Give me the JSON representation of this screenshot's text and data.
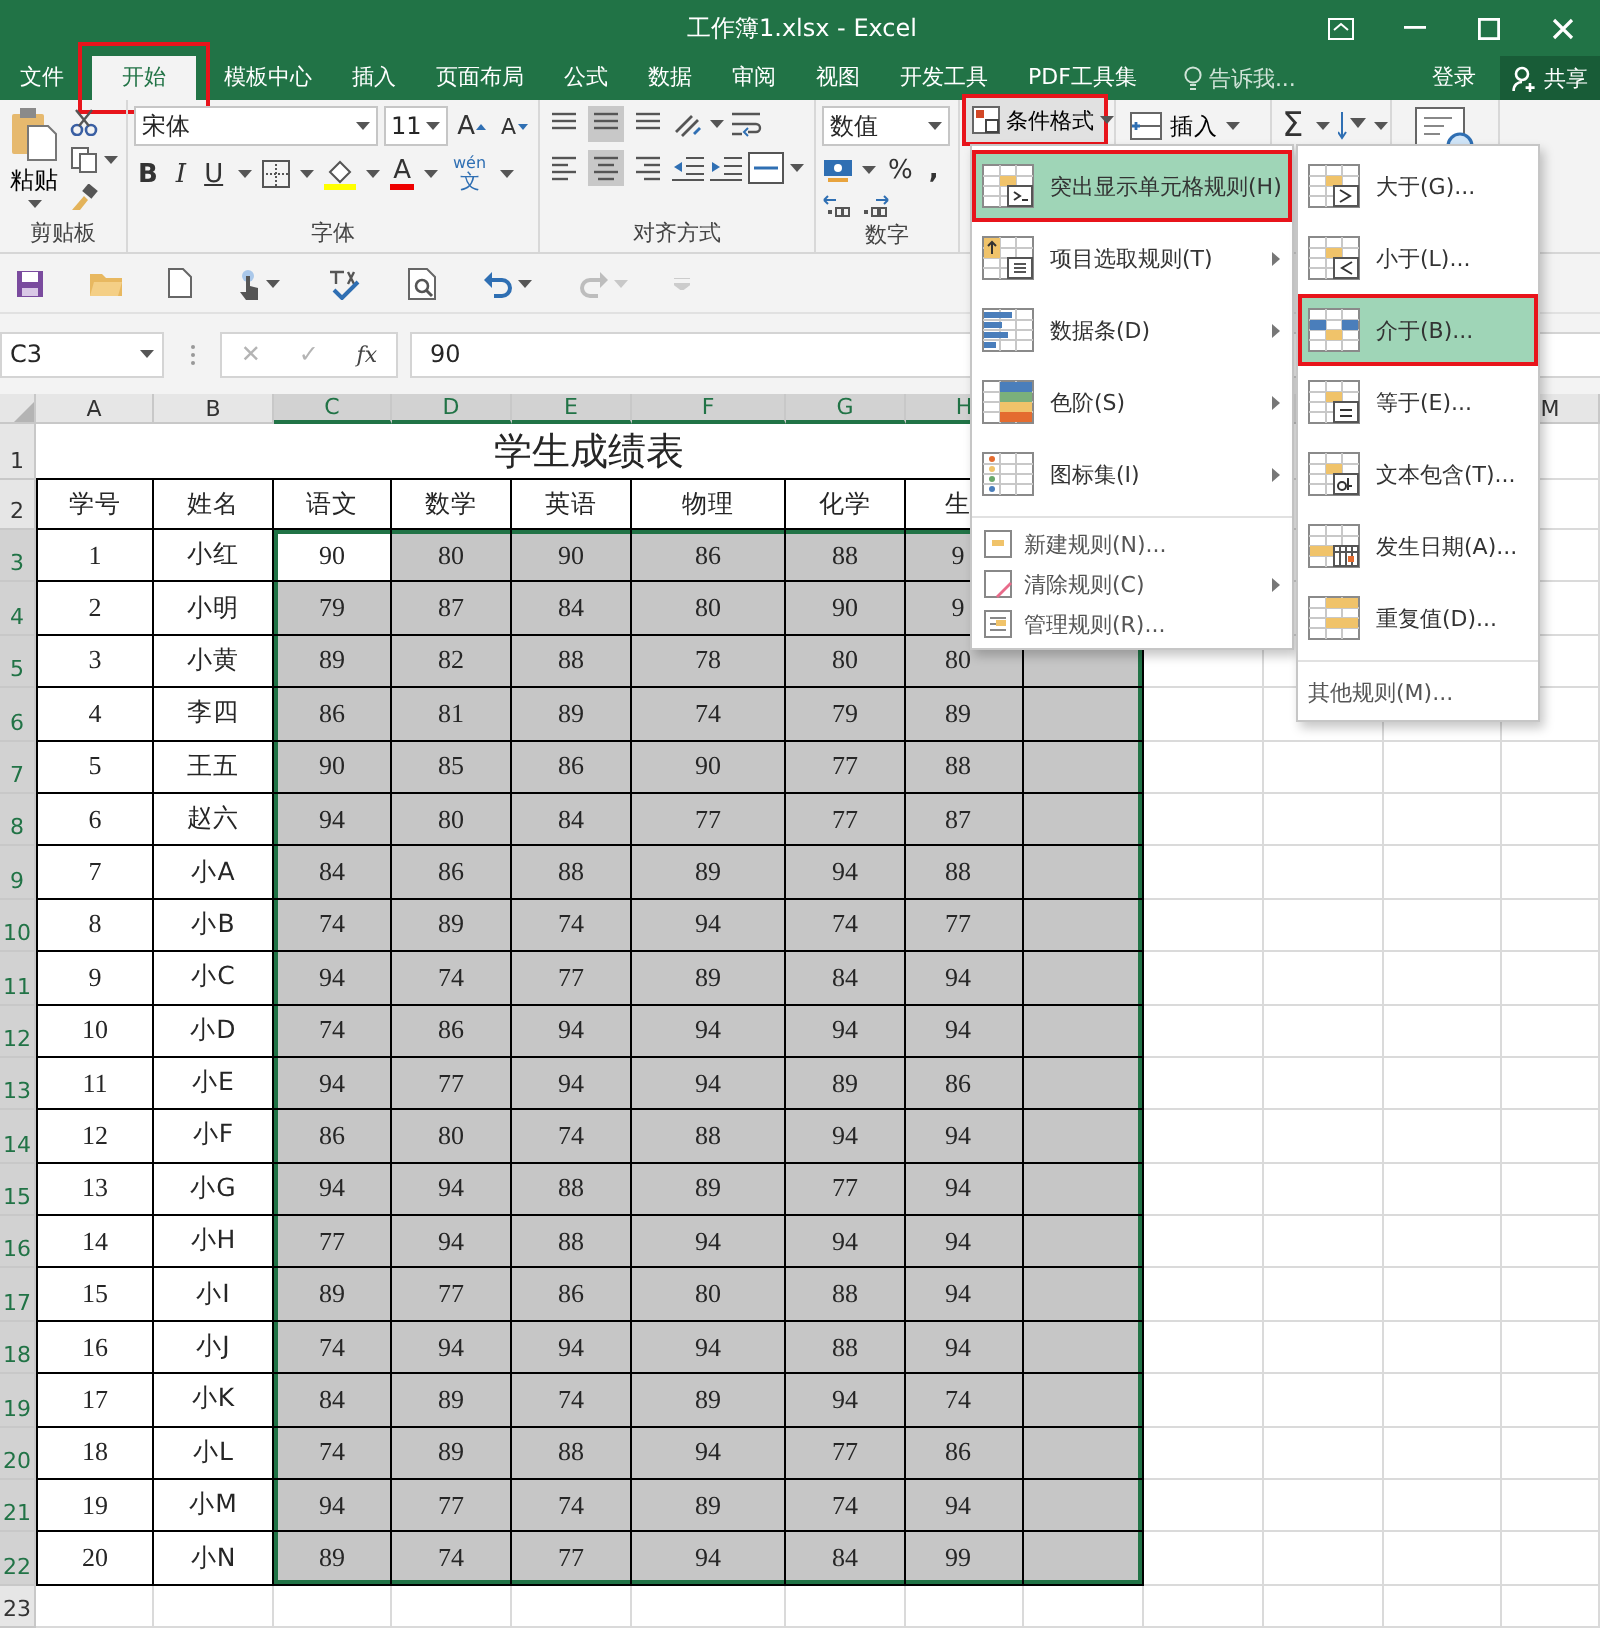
{
  "window": {
    "title": "工作簿1.xlsx - Excel"
  },
  "tabs": [
    {
      "label": "文件",
      "selected": false,
      "outlined": false
    },
    {
      "label": "开始",
      "selected": true,
      "outlined": true
    },
    {
      "label": "模板中心",
      "selected": false,
      "outlined": false
    },
    {
      "label": "插入",
      "selected": false,
      "outlined": false
    },
    {
      "label": "页面布局",
      "selected": false,
      "outlined": false
    },
    {
      "label": "公式",
      "selected": false,
      "outlined": false
    },
    {
      "label": "数据",
      "selected": false,
      "outlined": false
    },
    {
      "label": "审阅",
      "selected": false,
      "outlined": false
    },
    {
      "label": "视图",
      "selected": false,
      "outlined": false
    },
    {
      "label": "开发工具",
      "selected": false,
      "outlined": false
    },
    {
      "label": "PDF工具集",
      "selected": false,
      "outlined": false
    }
  ],
  "tell_me": {
    "placeholder": "告诉我..."
  },
  "account": {
    "sign_in": "登录",
    "share": "共享"
  },
  "ribbon": {
    "clipboard": {
      "paste": "粘贴",
      "label": "剪贴板"
    },
    "font": {
      "name": "宋体",
      "size": "11",
      "grow": "A",
      "shrink": "A",
      "bold": "B",
      "italic": "I",
      "underline": "U",
      "color_letter": "A",
      "phonetic_top": "wén",
      "phonetic_bottom": "文",
      "label": "字体"
    },
    "alignment": {
      "label": "对齐方式"
    },
    "number": {
      "format": "数值",
      "percent": "%",
      "comma": ",",
      "label": "数字"
    },
    "conditional_format": {
      "label": "条件格式",
      "outlined": true
    },
    "insert": {
      "label": "插入"
    },
    "sum": "Σ"
  },
  "formula_bar": {
    "name_box": "C3",
    "cancel": "✕",
    "enter": "✓",
    "fx": "fx",
    "value": "90"
  },
  "sheet": {
    "columns": [
      {
        "label": "A",
        "selected": false
      },
      {
        "label": "B",
        "selected": false
      },
      {
        "label": "C",
        "selected": true
      },
      {
        "label": "D",
        "selected": true
      },
      {
        "label": "E",
        "selected": true
      },
      {
        "label": "F",
        "selected": true
      },
      {
        "label": "G",
        "selected": true
      },
      {
        "label": "H",
        "selected": true
      }
    ],
    "column_m": {
      "label": "M",
      "selected": false
    },
    "title_row": "1",
    "title": "学生成绩表",
    "header_row": "2",
    "header": [
      "学号",
      "姓名",
      "语文",
      "数学",
      "英语",
      "物理",
      "化学",
      "生"
    ],
    "rows": [
      {
        "number": "3",
        "selected": true,
        "id": "1",
        "name": "小红",
        "scores": [
          {
            "text": "90",
            "selected": false
          },
          {
            "text": "80",
            "selected": true
          },
          {
            "text": "90",
            "selected": true
          },
          {
            "text": "86",
            "selected": true
          },
          {
            "text": "88",
            "selected": true
          },
          {
            "text": "9",
            "selected": true
          }
        ]
      },
      {
        "number": "4",
        "selected": true,
        "id": "2",
        "name": "小明",
        "scores": [
          {
            "text": "79",
            "selected": true
          },
          {
            "text": "87",
            "selected": true
          },
          {
            "text": "84",
            "selected": true
          },
          {
            "text": "80",
            "selected": true
          },
          {
            "text": "90",
            "selected": true
          },
          {
            "text": "9",
            "selected": true
          }
        ]
      },
      {
        "number": "5",
        "selected": true,
        "id": "3",
        "name": "小黄",
        "blank_selected": true,
        "scores": [
          {
            "text": "89",
            "selected": true
          },
          {
            "text": "82",
            "selected": true
          },
          {
            "text": "88",
            "selected": true
          },
          {
            "text": "78",
            "selected": true
          },
          {
            "text": "80",
            "selected": true
          },
          {
            "text": "80",
            "selected": true
          }
        ]
      },
      {
        "number": "6",
        "selected": true,
        "id": "4",
        "name": "李四",
        "blank_selected": true,
        "scores": [
          {
            "text": "86",
            "selected": true
          },
          {
            "text": "81",
            "selected": true
          },
          {
            "text": "89",
            "selected": true
          },
          {
            "text": "74",
            "selected": true
          },
          {
            "text": "79",
            "selected": true
          },
          {
            "text": "89",
            "selected": true
          }
        ]
      },
      {
        "number": "7",
        "selected": true,
        "id": "5",
        "name": "王五",
        "blank_selected": true,
        "scores": [
          {
            "text": "90",
            "selected": true
          },
          {
            "text": "85",
            "selected": true
          },
          {
            "text": "86",
            "selected": true
          },
          {
            "text": "90",
            "selected": true
          },
          {
            "text": "77",
            "selected": true
          },
          {
            "text": "88",
            "selected": true
          }
        ]
      },
      {
        "number": "8",
        "selected": true,
        "id": "6",
        "name": "赵六",
        "blank_selected": true,
        "scores": [
          {
            "text": "94",
            "selected": true
          },
          {
            "text": "80",
            "selected": true
          },
          {
            "text": "84",
            "selected": true
          },
          {
            "text": "77",
            "selected": true
          },
          {
            "text": "77",
            "selected": true
          },
          {
            "text": "87",
            "selected": true
          }
        ]
      },
      {
        "number": "9",
        "selected": true,
        "id": "7",
        "name": "小A",
        "blank_selected": true,
        "scores": [
          {
            "text": "84",
            "selected": true
          },
          {
            "text": "86",
            "selected": true
          },
          {
            "text": "88",
            "selected": true
          },
          {
            "text": "89",
            "selected": true
          },
          {
            "text": "94",
            "selected": true
          },
          {
            "text": "88",
            "selected": true
          }
        ]
      },
      {
        "number": "10",
        "selected": true,
        "id": "8",
        "name": "小B",
        "blank_selected": true,
        "scores": [
          {
            "text": "74",
            "selected": true
          },
          {
            "text": "89",
            "selected": true
          },
          {
            "text": "74",
            "selected": true
          },
          {
            "text": "94",
            "selected": true
          },
          {
            "text": "74",
            "selected": true
          },
          {
            "text": "77",
            "selected": true
          }
        ]
      },
      {
        "number": "11",
        "selected": true,
        "id": "9",
        "name": "小C",
        "blank_selected": true,
        "scores": [
          {
            "text": "94",
            "selected": true
          },
          {
            "text": "74",
            "selected": true
          },
          {
            "text": "77",
            "selected": true
          },
          {
            "text": "89",
            "selected": true
          },
          {
            "text": "84",
            "selected": true
          },
          {
            "text": "94",
            "selected": true
          }
        ]
      },
      {
        "number": "12",
        "selected": true,
        "id": "10",
        "name": "小D",
        "blank_selected": true,
        "scores": [
          {
            "text": "74",
            "selected": true
          },
          {
            "text": "86",
            "selected": true
          },
          {
            "text": "94",
            "selected": true
          },
          {
            "text": "94",
            "selected": true
          },
          {
            "text": "94",
            "selected": true
          },
          {
            "text": "94",
            "selected": true
          }
        ]
      },
      {
        "number": "13",
        "selected": true,
        "id": "11",
        "name": "小E",
        "blank_selected": true,
        "scores": [
          {
            "text": "94",
            "selected": true
          },
          {
            "text": "77",
            "selected": true
          },
          {
            "text": "94",
            "selected": true
          },
          {
            "text": "94",
            "selected": true
          },
          {
            "text": "89",
            "selected": true
          },
          {
            "text": "86",
            "selected": true
          }
        ]
      },
      {
        "number": "14",
        "selected": true,
        "id": "12",
        "name": "小F",
        "blank_selected": true,
        "scores": [
          {
            "text": "86",
            "selected": true
          },
          {
            "text": "80",
            "selected": true
          },
          {
            "text": "74",
            "selected": true
          },
          {
            "text": "88",
            "selected": true
          },
          {
            "text": "94",
            "selected": true
          },
          {
            "text": "94",
            "selected": true
          }
        ]
      },
      {
        "number": "15",
        "selected": true,
        "id": "13",
        "name": "小G",
        "blank_selected": true,
        "scores": [
          {
            "text": "94",
            "selected": true
          },
          {
            "text": "94",
            "selected": true
          },
          {
            "text": "88",
            "selected": true
          },
          {
            "text": "89",
            "selected": true
          },
          {
            "text": "77",
            "selected": true
          },
          {
            "text": "94",
            "selected": true
          }
        ]
      },
      {
        "number": "16",
        "selected": true,
        "id": "14",
        "name": "小H",
        "blank_selected": true,
        "scores": [
          {
            "text": "77",
            "selected": true
          },
          {
            "text": "94",
            "selected": true
          },
          {
            "text": "88",
            "selected": true
          },
          {
            "text": "94",
            "selected": true
          },
          {
            "text": "94",
            "selected": true
          },
          {
            "text": "94",
            "selected": true
          }
        ]
      },
      {
        "number": "17",
        "selected": true,
        "id": "15",
        "name": "小I",
        "blank_selected": true,
        "scores": [
          {
            "text": "89",
            "selected": true
          },
          {
            "text": "77",
            "selected": true
          },
          {
            "text": "86",
            "selected": true
          },
          {
            "text": "80",
            "selected": true
          },
          {
            "text": "88",
            "selected": true
          },
          {
            "text": "94",
            "selected": true
          }
        ]
      },
      {
        "number": "18",
        "selected": true,
        "id": "16",
        "name": "小J",
        "blank_selected": true,
        "scores": [
          {
            "text": "74",
            "selected": true
          },
          {
            "text": "94",
            "selected": true
          },
          {
            "text": "94",
            "selected": true
          },
          {
            "text": "94",
            "selected": true
          },
          {
            "text": "88",
            "selected": true
          },
          {
            "text": "94",
            "selected": true
          }
        ]
      },
      {
        "number": "19",
        "selected": true,
        "id": "17",
        "name": "小K",
        "blank_selected": true,
        "scores": [
          {
            "text": "84",
            "selected": true
          },
          {
            "text": "89",
            "selected": true
          },
          {
            "text": "74",
            "selected": true
          },
          {
            "text": "89",
            "selected": true
          },
          {
            "text": "94",
            "selected": true
          },
          {
            "text": "74",
            "selected": true
          }
        ]
      },
      {
        "number": "20",
        "selected": true,
        "id": "18",
        "name": "小L",
        "blank_selected": true,
        "scores": [
          {
            "text": "74",
            "selected": true
          },
          {
            "text": "89",
            "selected": true
          },
          {
            "text": "88",
            "selected": true
          },
          {
            "text": "94",
            "selected": true
          },
          {
            "text": "77",
            "selected": true
          },
          {
            "text": "86",
            "selected": true
          }
        ]
      },
      {
        "number": "21",
        "selected": true,
        "id": "19",
        "name": "小M",
        "blank_selected": true,
        "scores": [
          {
            "text": "94",
            "selected": true
          },
          {
            "text": "77",
            "selected": true
          },
          {
            "text": "74",
            "selected": true
          },
          {
            "text": "89",
            "selected": true
          },
          {
            "text": "74",
            "selected": true
          },
          {
            "text": "94",
            "selected": true
          }
        ]
      },
      {
        "number": "22",
        "selected": true,
        "id": "20",
        "name": "小N",
        "blank_selected": true,
        "scores": [
          {
            "text": "89",
            "selected": true
          },
          {
            "text": "74",
            "selected": true
          },
          {
            "text": "77",
            "selected": true
          },
          {
            "text": "94",
            "selected": true
          },
          {
            "text": "84",
            "selected": true
          },
          {
            "text": "99",
            "selected": true
          }
        ]
      }
    ],
    "last_row": "23"
  },
  "menu": {
    "items": [
      {
        "kind": "large",
        "label": "突出显示单元格规则(H)",
        "submenu": true,
        "selected": true,
        "outlined": true
      },
      {
        "kind": "large",
        "label": "项目选取规则(T)",
        "submenu": true,
        "selected": false,
        "outlined": false
      },
      {
        "kind": "large",
        "label": "数据条(D)",
        "submenu": true,
        "selected": false,
        "outlined": false
      },
      {
        "kind": "large",
        "label": "色阶(S)",
        "submenu": true,
        "selected": false,
        "outlined": false
      },
      {
        "kind": "large",
        "label": "图标集(I)",
        "submenu": true,
        "selected": false,
        "outlined": false
      },
      {
        "kind": "small",
        "label": "新建规则(N)...",
        "submenu": false,
        "selected": false,
        "outlined": false
      },
      {
        "kind": "small",
        "label": "清除规则(C)",
        "submenu": true,
        "selected": false,
        "outlined": false
      },
      {
        "kind": "small",
        "label": "管理规则(R)...",
        "submenu": false,
        "selected": false,
        "outlined": false
      }
    ]
  },
  "submenu": {
    "items": [
      {
        "kind": "large",
        "label": "大于(G)...",
        "selected": false,
        "outlined": false
      },
      {
        "kind": "large",
        "label": "小于(L)...",
        "selected": false,
        "outlined": false
      },
      {
        "kind": "large",
        "label": "介于(B)...",
        "selected": true,
        "outlined": true
      },
      {
        "kind": "large",
        "label": "等于(E)...",
        "selected": false,
        "outlined": false
      },
      {
        "kind": "large",
        "label": "文本包含(T)...",
        "selected": false,
        "outlined": false
      },
      {
        "kind": "large",
        "label": "发生日期(A)...",
        "selected": false,
        "outlined": false
      },
      {
        "kind": "large",
        "label": "重复值(D)...",
        "selected": false,
        "outlined": false
      },
      {
        "kind": "footer",
        "label": "其他规则(M)...",
        "selected": false,
        "outlined": false
      }
    ]
  }
}
